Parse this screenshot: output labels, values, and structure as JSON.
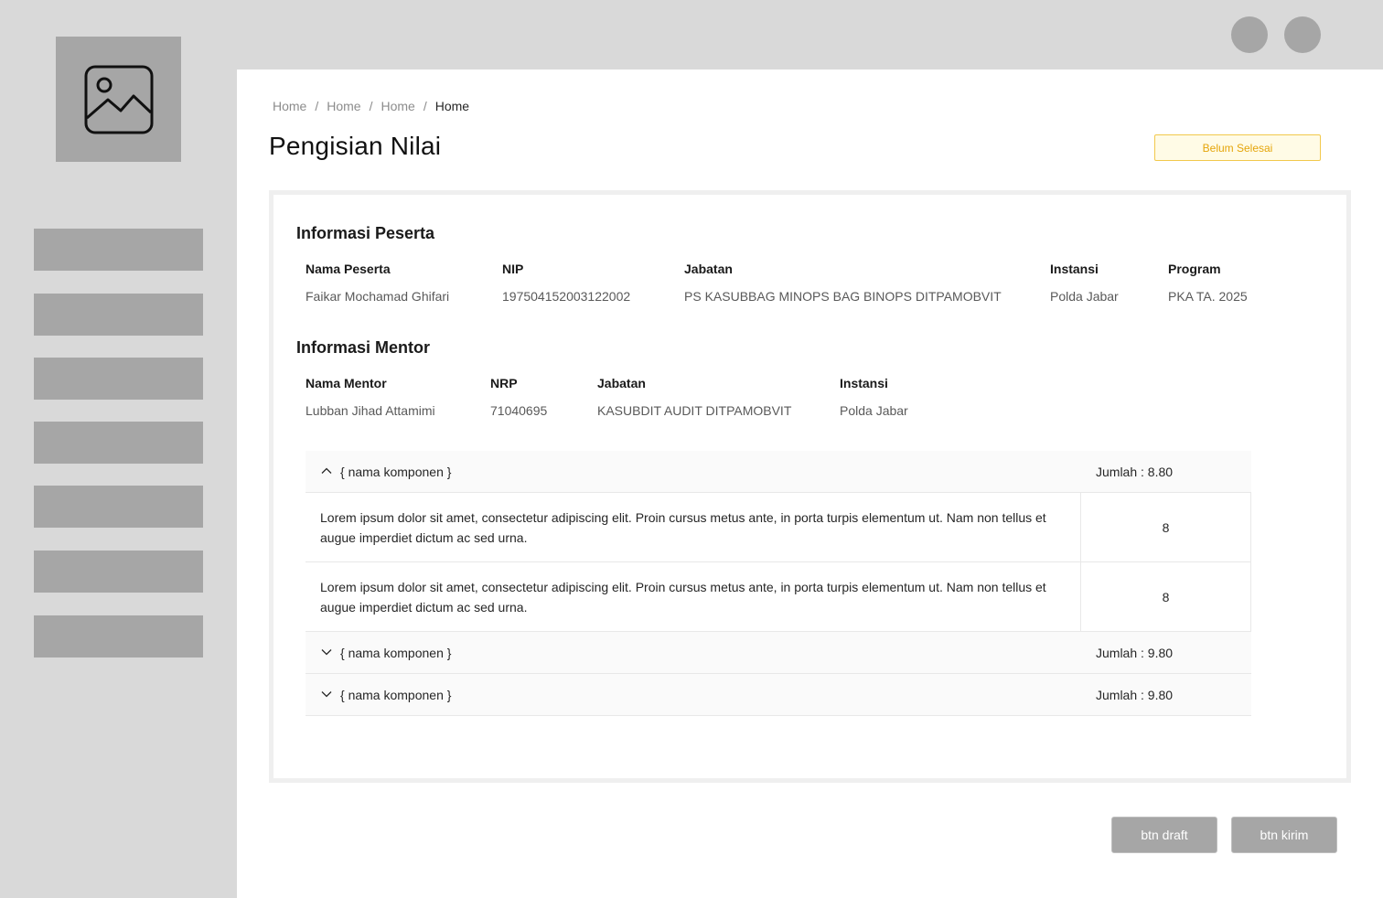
{
  "breadcrumb": {
    "items": [
      "Home",
      "Home",
      "Home"
    ],
    "current": "Home",
    "separator": "/"
  },
  "page": {
    "title": "Pengisian Nilai",
    "status": "Belum Selesai"
  },
  "peserta": {
    "section_title": "Informasi Peserta",
    "labels": {
      "nama": "Nama Peserta",
      "nip": "NIP",
      "jabatan": "Jabatan",
      "instansi": "Instansi",
      "program": "Program"
    },
    "values": {
      "nama": "Faikar Mochamad Ghifari",
      "nip": "197504152003122002",
      "jabatan": "PS KASUBBAG MINOPS BAG BINOPS DITPAMOBVIT",
      "instansi": "Polda Jabar",
      "program": "PKA TA. 2025"
    }
  },
  "mentor": {
    "section_title": "Informasi Mentor",
    "labels": {
      "nama": "Nama Mentor",
      "nrp": "NRP",
      "jabatan": "Jabatan",
      "instansi": "Instansi"
    },
    "values": {
      "nama": "Lubban Jihad Attamimi",
      "nrp": "71040695",
      "jabatan": "KASUBDIT AUDIT DITPAMOBVIT",
      "instansi": "Polda Jabar"
    }
  },
  "components": [
    {
      "name": "{ nama komponen }",
      "total": "Jumlah : 8.80",
      "expanded": true,
      "icon": "chevron-up-icon",
      "rows": [
        {
          "desc": "Lorem ipsum dolor sit amet, consectetur adipiscing elit. Proin cursus metus ante, in porta turpis elementum ut. Nam non tellus et augue imperdiet dictum ac sed urna.",
          "score": "8"
        },
        {
          "desc": "Lorem ipsum dolor sit amet, consectetur adipiscing elit. Proin cursus metus ante, in porta turpis elementum ut. Nam non tellus et augue imperdiet dictum ac sed urna.",
          "score": "8"
        }
      ]
    },
    {
      "name": "{ nama komponen }",
      "total": "Jumlah : 9.80",
      "expanded": false,
      "icon": "chevron-down-icon"
    },
    {
      "name": "{ nama komponen }",
      "total": "Jumlah : 9.80",
      "expanded": false,
      "icon": "chevron-down-icon"
    }
  ],
  "buttons": {
    "draft": "btn draft",
    "kirim": "btn kirim"
  },
  "icons": {
    "logo": "image-placeholder-icon"
  },
  "colors": {
    "status_border": "#f2c94c",
    "status_text": "#e5a50a",
    "status_bg": "#fffbe6",
    "placeholder_gray": "#a6a6a6"
  }
}
